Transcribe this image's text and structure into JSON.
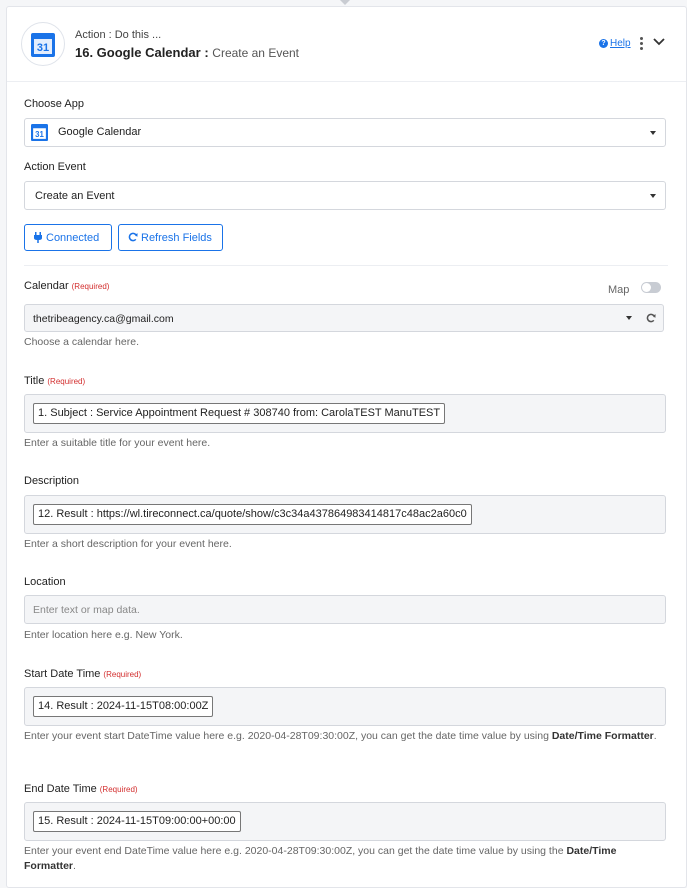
{
  "header": {
    "subtitle": "Action : Do this ...",
    "title": "16. Google Calendar :",
    "event": "Create an Event",
    "help": "Help",
    "app_icon": "google-calendar-icon",
    "icon_day": "31"
  },
  "choose_app": {
    "label": "Choose App",
    "value": "Google Calendar"
  },
  "action_event": {
    "label": "Action Event",
    "value": "Create an Event"
  },
  "buttons": {
    "connected": "Connected",
    "refresh": "Refresh Fields"
  },
  "calendar": {
    "label": "Calendar",
    "required": "(Required)",
    "map": "Map",
    "value": "thetribeagency.ca@gmail.com",
    "help": "Choose a calendar here."
  },
  "title_field": {
    "label": "Title",
    "required": "(Required)",
    "token": "1. Subject : Service Appointment Request # 308740 from: CarolaTEST ManuTEST",
    "help": "Enter a suitable title for your event here."
  },
  "description": {
    "label": "Description",
    "token": "12. Result : https://wl.tireconnect.ca/quote/show/c3c34a437864983414817c48ac2a60c0",
    "help": "Enter a short description for your event here."
  },
  "location": {
    "label": "Location",
    "placeholder": "Enter text or map data.",
    "help": "Enter location here e.g. New York."
  },
  "start": {
    "label": "Start Date Time",
    "required": "(Required)",
    "token": "14. Result : 2024-11-15T08:00:00Z",
    "help_pre": "Enter your event start DateTime value here e.g. 2020-04-28T09:30:00Z, you can get the date time value by using",
    "help_link": "Date/Time Formatter",
    "help_post": "."
  },
  "end": {
    "label": "End Date Time",
    "required": "(Required)",
    "token": "15. Result : 2024-11-15T09:00:00+00:00",
    "help_pre": "Enter your event end DateTime value here e.g. 2020-04-28T09:30:00Z, you can get the date time value by using the",
    "help_link": "Date/Time Formatter",
    "help_post": "."
  },
  "colors": {
    "accent": "#1a73e8",
    "required": "#d32f2f"
  }
}
